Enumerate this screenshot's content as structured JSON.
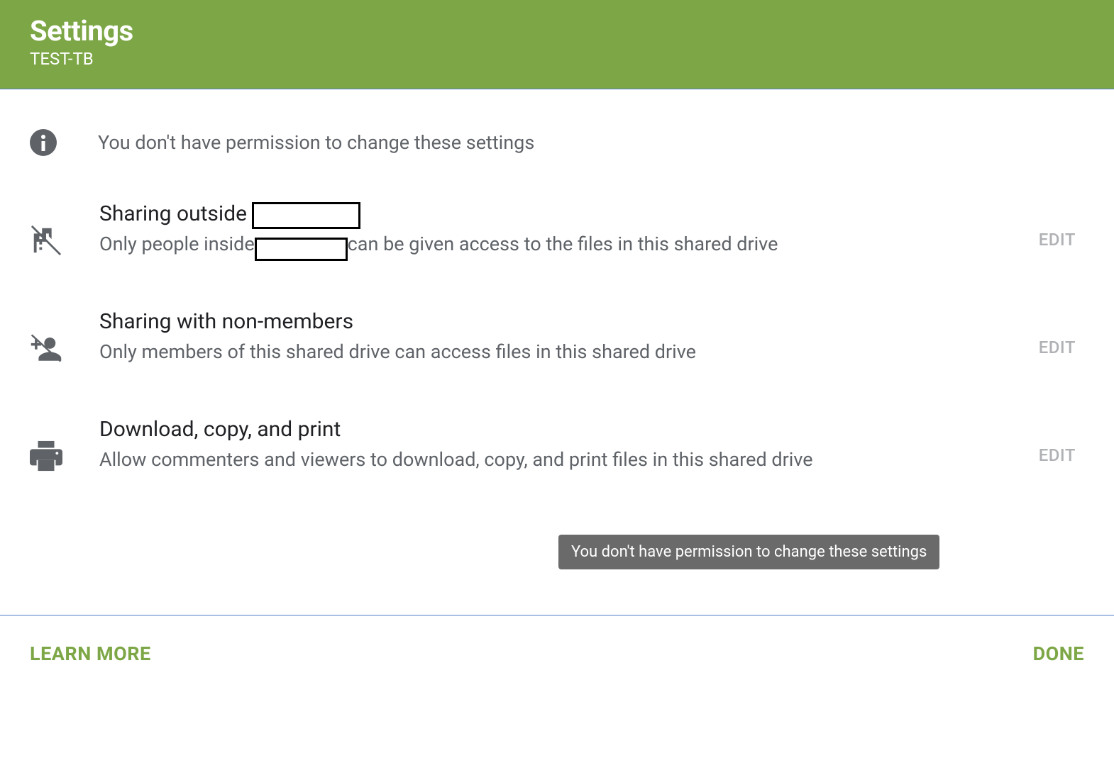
{
  "header": {
    "title": "Settings",
    "subtitle": "TEST-TB"
  },
  "notice": {
    "text": "You don't have permission to change these settings"
  },
  "settings": {
    "sharing_outside": {
      "title_prefix": "Sharing outside ",
      "desc_prefix": "Only people inside",
      "desc_suffix": "can be given access to the files in this shared drive",
      "edit_label": "EDIT"
    },
    "sharing_non_members": {
      "title": "Sharing with non-members",
      "desc": "Only members of this shared drive can access files in this shared drive",
      "edit_label": "EDIT"
    },
    "download_copy_print": {
      "title": "Download, copy, and print",
      "desc": "Allow commenters and viewers to download, copy, and print files in this shared drive",
      "edit_label": "EDIT"
    }
  },
  "tooltip": {
    "text": "You don't have permission to change these settings"
  },
  "footer": {
    "learn_more": "LEARN MORE",
    "done": "DONE"
  }
}
